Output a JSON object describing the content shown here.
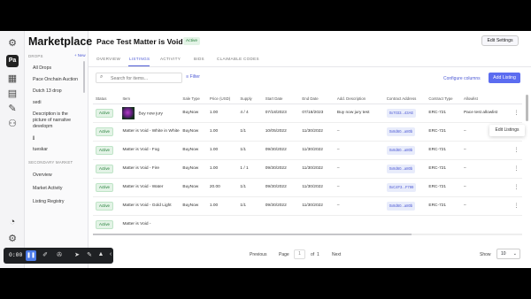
{
  "rail": {
    "logo_label": "Pa"
  },
  "sidebar": {
    "title": "Marketplace",
    "drops_header": "DROPS",
    "new_label": "+ New",
    "items": [
      {
        "label": "All Drops"
      },
      {
        "label": "Pace Onchain Auction"
      },
      {
        "label": "Dutch 13 drop"
      },
      {
        "label": "sedi"
      },
      {
        "label": "Description is the picture of narrative developm"
      },
      {
        "label": "jj"
      },
      {
        "label": "tueskar"
      }
    ],
    "secondary_header": "SECONDARY MARKET",
    "secondary_items": [
      {
        "label": "Overview"
      },
      {
        "label": "Market Activity"
      },
      {
        "label": "Listing Registry"
      }
    ]
  },
  "header": {
    "title": "Pace Test Matter is Void",
    "status": "Active",
    "edit_settings": "Edit Settings"
  },
  "tabs": [
    {
      "label": "OVERVIEW"
    },
    {
      "label": "LISTINGS"
    },
    {
      "label": "ACTIVITY"
    },
    {
      "label": "BIDS"
    },
    {
      "label": "CLAIMABLE CODES"
    }
  ],
  "toolbar": {
    "search_placeholder": "Search for items...",
    "filter": "Filter",
    "configure": "Configure columns",
    "add_listing": "Add Listing"
  },
  "table": {
    "columns": [
      "Status",
      "Item",
      "Sale Type",
      "Price (USD)",
      "Supply",
      "Start Date",
      "End Date",
      "Add. Description",
      "Contract Address",
      "Contract Type",
      "Allowlist"
    ],
    "rows": [
      {
        "status": "Active",
        "item": "Buy now jury",
        "sale_type": "BuyNow",
        "price": "1.00",
        "supply": "4 / 4",
        "start": "07/18/2023",
        "end": "07/18/2023",
        "desc": "Buy now jury test",
        "address": "0x7033...43AE",
        "type": "ERC-721",
        "allowlist": "Pace test allowlist"
      },
      {
        "status": "Active",
        "item": "Matter is Void - White in White",
        "sale_type": "BuyNow",
        "price": "1.00",
        "supply": "1/1",
        "start": "10/05/2022",
        "end": "11/30/2022",
        "desc": "–",
        "address": "0x8d60...a80b",
        "type": "ERC-721",
        "allowlist": "–"
      },
      {
        "status": "Active",
        "item": "Matter is Void - Fog",
        "sale_type": "BuyNow",
        "price": "1.00",
        "supply": "1/1",
        "start": "09/30/2022",
        "end": "11/30/2022",
        "desc": "–",
        "address": "0x8d60...a80b",
        "type": "ERC-721",
        "allowlist": "–"
      },
      {
        "status": "Active",
        "item": "Matter is Void - Fire",
        "sale_type": "BuyNow",
        "price": "1.00",
        "supply": "1 / 1",
        "start": "09/30/2022",
        "end": "11/30/2022",
        "desc": "–",
        "address": "0x8d60...a80b",
        "type": "ERC-721",
        "allowlist": "–"
      },
      {
        "status": "Active",
        "item": "Matter is Void - Water",
        "sale_type": "BuyNow",
        "price": "20.00",
        "supply": "1/1",
        "start": "09/30/2022",
        "end": "11/30/2022",
        "desc": "–",
        "address": "0xC4F3...F799",
        "type": "ERC-721",
        "allowlist": "–"
      },
      {
        "status": "Active",
        "item": "Matter is Void - Gold Light",
        "sale_type": "BuyNow",
        "price": "1.00",
        "supply": "1/1",
        "start": "09/30/2022",
        "end": "11/30/2022",
        "desc": "–",
        "address": "0x8d60...a80b",
        "type": "ERC-721",
        "allowlist": "–"
      },
      {
        "status": "Active",
        "item": "Matter is Void -",
        "sale_type": "",
        "price": "",
        "supply": "",
        "start": "",
        "end": "",
        "desc": "",
        "address": "",
        "type": "",
        "allowlist": ""
      }
    ]
  },
  "row_menu": {
    "edit": "Edit Listings"
  },
  "pagination": {
    "previous": "Previous",
    "page": "Page",
    "current": "1",
    "of": "of",
    "total": "1",
    "next": "Next",
    "show": "Show",
    "show_value": "10"
  },
  "recorder": {
    "time": "0:00"
  }
}
